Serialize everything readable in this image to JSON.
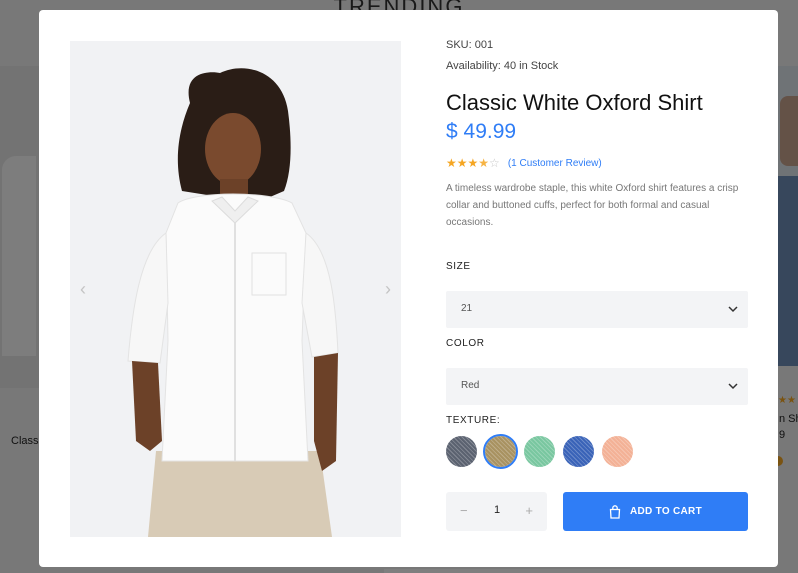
{
  "background": {
    "heading": "TRENDING",
    "left_product_title": "Classic",
    "right_product_title": "n Shi",
    "right_product_price": "9",
    "right_product_stars": "★★"
  },
  "gallery": {
    "prev_arrow": "‹",
    "next_arrow": "›"
  },
  "product": {
    "sku": "SKU: 001",
    "availability": "Availability: 40 in Stock",
    "title": "Classic White Oxford Shirt",
    "price": "$ 49.99",
    "rating": 3.5,
    "stars_full": "★★★",
    "stars_half": "★",
    "stars_empty": "☆",
    "review_link": "(1 Customer Review)",
    "description": "A timeless wardrobe staple, this white Oxford shirt features a crisp collar and buttoned cuffs, perfect for both formal and casual occasions."
  },
  "options": {
    "size_label": "SIZE",
    "size_value": "21",
    "color_label": "COLOR",
    "color_value": "Red",
    "texture_label": "TEXTURE:",
    "textures": [
      {
        "name": "denim-gray",
        "color": "#5b6270",
        "selected": false
      },
      {
        "name": "khaki-twill",
        "color": "#a89261",
        "selected": true
      },
      {
        "name": "green-weave",
        "color": "#79c7a0",
        "selected": false
      },
      {
        "name": "blue-denim",
        "color": "#3a63b8",
        "selected": false
      },
      {
        "name": "peach-linen",
        "color": "#f3b196",
        "selected": false
      }
    ]
  },
  "cart": {
    "quantity": "1",
    "minus": "−",
    "plus": "+",
    "add_label": "ADD TO CART"
  },
  "colors": {
    "accent": "#2f7df6",
    "star": "#f5a623"
  }
}
